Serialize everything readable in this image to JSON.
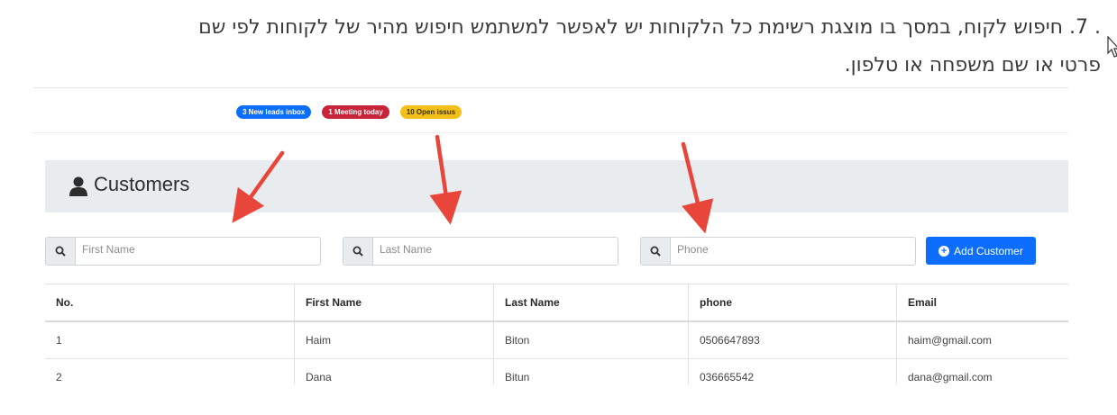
{
  "document": {
    "step_number": "7",
    "line1": ". 7. חיפוש לקוח, במסך בו מוצגת רשימת כל הלקוחות יש לאפשר למשתמש חיפוש מהיר של לקוחות לפי שם",
    "line2": "פרטי או שם משפחה או טלפון."
  },
  "app": {
    "badges": [
      {
        "label": "3 New leads inbox",
        "color": "#0d6efd"
      },
      {
        "label": "1 Meeting today",
        "color": "#c8243a"
      },
      {
        "label": "10 Open issus",
        "color": "#f3c019"
      }
    ],
    "page_title": "Customers",
    "search": {
      "first_name_placeholder": "First Name",
      "last_name_placeholder": "Last Name",
      "phone_placeholder": "Phone"
    },
    "add_button_label": "Add Customer",
    "table": {
      "headers": [
        "No.",
        "First Name",
        "Last Name",
        "phone",
        "Email"
      ],
      "rows": [
        [
          "1",
          "Haim",
          "Biton",
          "0506647893",
          "haim@gmail.com"
        ],
        [
          "2",
          "Dana",
          "Bitun",
          "036665542",
          "dana@gmail.com"
        ]
      ]
    }
  },
  "icons": {
    "search": "search-icon",
    "user": "user-icon",
    "plus": "plus-circle-icon",
    "cursor": "mouse-cursor-icon",
    "annotation": "red-arrow-icon"
  },
  "colors": {
    "accent": "#0d6efd",
    "arrow": "#e8463b",
    "header_bg": "#e9ecef"
  }
}
